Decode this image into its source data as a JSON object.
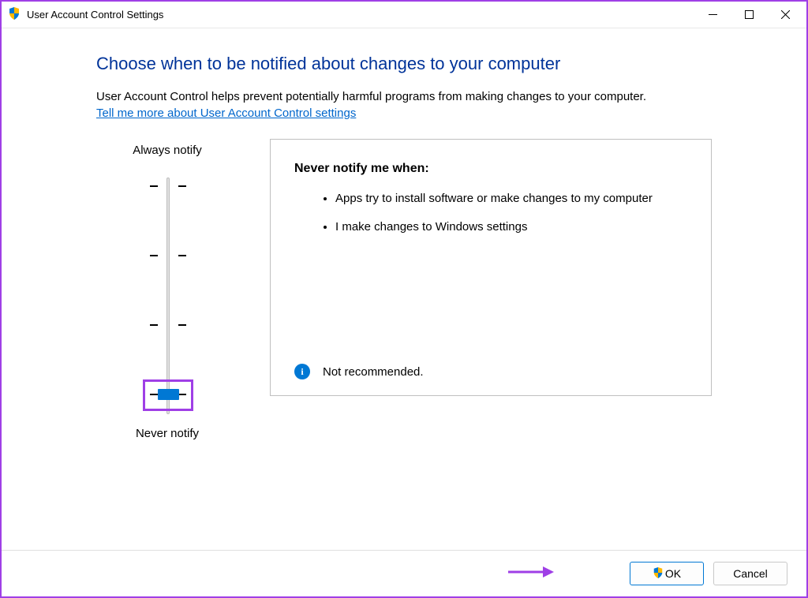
{
  "window": {
    "title": "User Account Control Settings"
  },
  "header": {
    "heading": "Choose when to be notified about changes to your computer",
    "description": "User Account Control helps prevent potentially harmful programs from making changes to your computer.",
    "link": "Tell me more about User Account Control settings"
  },
  "slider": {
    "top_label": "Always notify",
    "bottom_label": "Never notify",
    "position_index": 3,
    "positions": 4
  },
  "info": {
    "title": "Never notify me when:",
    "bullets": [
      "Apps try to install software or make changes to my computer",
      "I make changes to Windows settings"
    ],
    "status": "Not recommended."
  },
  "footer": {
    "ok": "OK",
    "cancel": "Cancel"
  },
  "icons": {
    "shield": "shield-icon",
    "info": "info-icon",
    "minimize": "minimize-icon",
    "maximize": "maximize-icon",
    "close": "close-icon"
  },
  "colors": {
    "accent": "#0078d4",
    "annotation": "#9f3fe6",
    "heading": "#003399"
  }
}
